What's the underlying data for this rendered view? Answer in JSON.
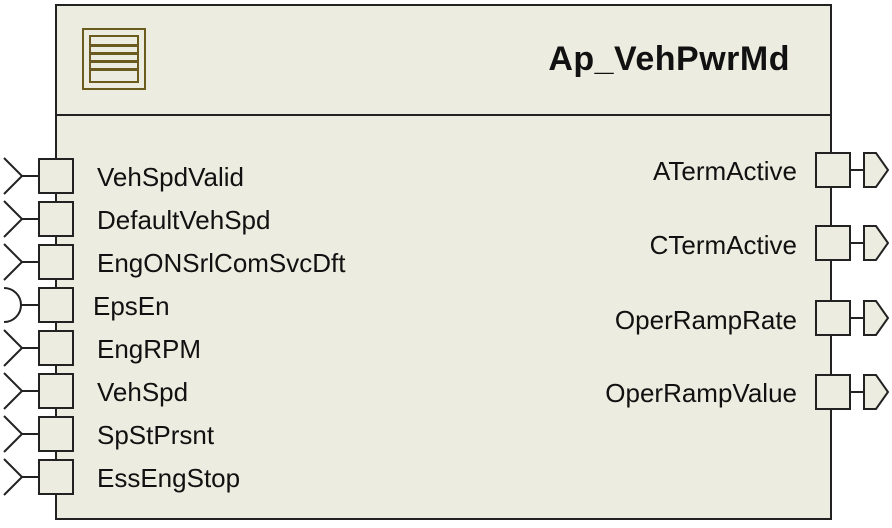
{
  "component": {
    "name": "Ap_VehPwrMd",
    "icon": "component-icon"
  },
  "inputs": [
    {
      "label": "VehSpdValid",
      "kind": "receiver"
    },
    {
      "label": "DefaultVehSpd",
      "kind": "receiver"
    },
    {
      "label": "EngONSrlComSvcDft",
      "kind": "receiver"
    },
    {
      "label": "EpsEn",
      "kind": "client"
    },
    {
      "label": "EngRPM",
      "kind": "receiver"
    },
    {
      "label": "VehSpd",
      "kind": "receiver"
    },
    {
      "label": "SpStPrsnt",
      "kind": "receiver"
    },
    {
      "label": "EssEngStop",
      "kind": "receiver"
    }
  ],
  "outputs": [
    {
      "label": "ATermActive",
      "kind": "sender"
    },
    {
      "label": "CTermActive",
      "kind": "sender"
    },
    {
      "label": "OperRampRate",
      "kind": "sender"
    },
    {
      "label": "OperRampValue",
      "kind": "sender"
    }
  ],
  "colors": {
    "body": "#ecece0",
    "border": "#222222",
    "icon": "#6b5b1f"
  }
}
